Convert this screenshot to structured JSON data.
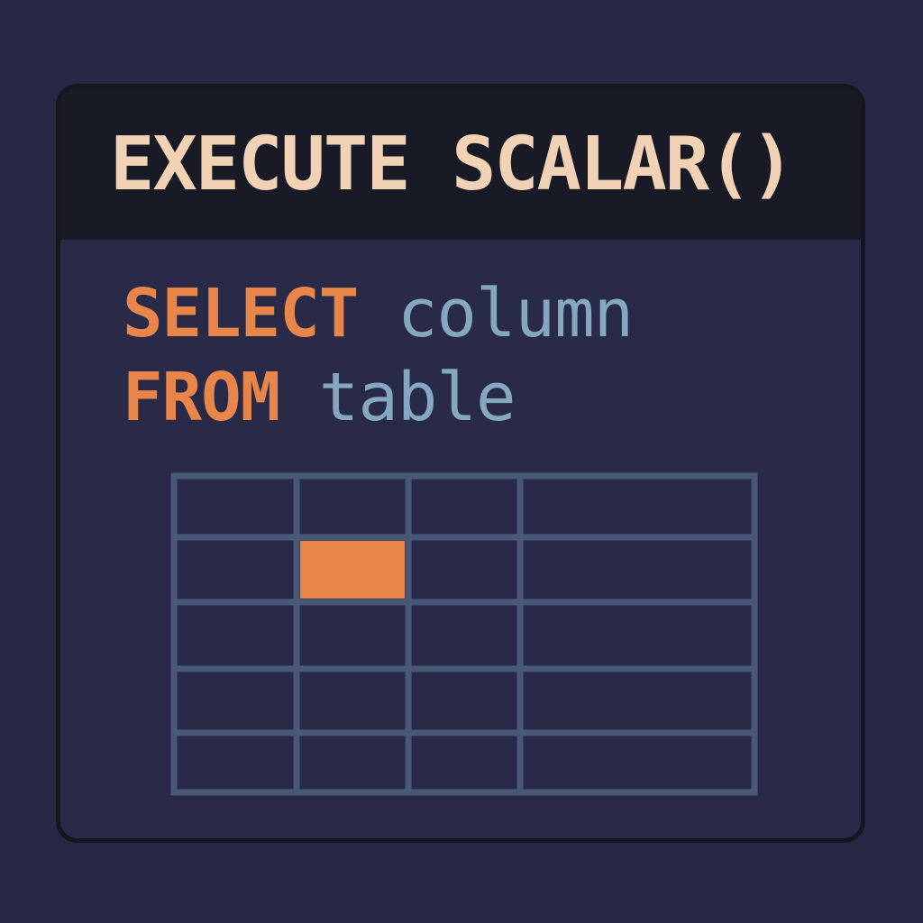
{
  "title": "EXECUTE SCALAR()",
  "query": {
    "line1": {
      "keyword": "SELECT",
      "identifier": "column"
    },
    "line2": {
      "keyword": "FROM",
      "identifier": "table"
    }
  },
  "result_grid": {
    "rows": 5,
    "columns": 4,
    "highlighted_cell": {
      "row": 2,
      "column": 2
    }
  },
  "colors": {
    "background": "#262742",
    "header": "#181a26",
    "title": "#f2d2b4",
    "keyword": "#e8864a",
    "identifier": "#86a8bf",
    "grid_line": "#4a5878",
    "highlight": "#e8864a"
  }
}
